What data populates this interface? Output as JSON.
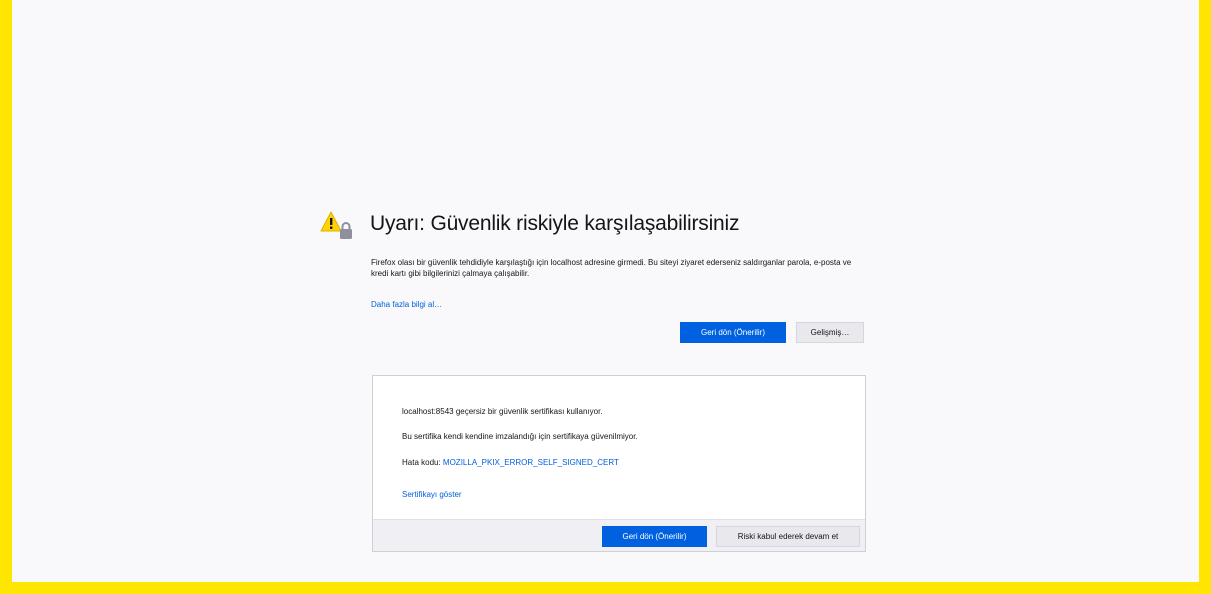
{
  "page": {
    "accent_color": "#0061e0",
    "border_color": "#ffe600",
    "warning_icon": "warning-lock-icon"
  },
  "error": {
    "title": "Uyarı: Güvenlik riskiyle karşılaşabilirsiniz",
    "description": "Firefox olası bir güvenlik tehdidiyle karşılaştığı için localhost adresine girmedi. Bu siteyi ziyaret ederseniz saldırganlar parola, e-posta ve kredi kartı gibi bilgilerinizi çalmaya çalışabilir.",
    "learn_more": "Daha fazla bilgi al…",
    "back_button": "Geri dön (Önerilir)",
    "advanced_button": "Gelişmiş…"
  },
  "advanced": {
    "line1": "localhost:8543 geçersiz bir güvenlik sertifikası kullanıyor.",
    "line2": "Bu sertifika kendi kendine imzalandığı için sertifikaya güvenilmiyor.",
    "error_code_label": "Hata kodu: ",
    "error_code": "MOZILLA_PKIX_ERROR_SELF_SIGNED_CERT",
    "view_certificate": "Sertifikayı göster",
    "back_button": "Geri dön (Önerilir)",
    "accept_button": "Riski kabul ederek devam et"
  }
}
